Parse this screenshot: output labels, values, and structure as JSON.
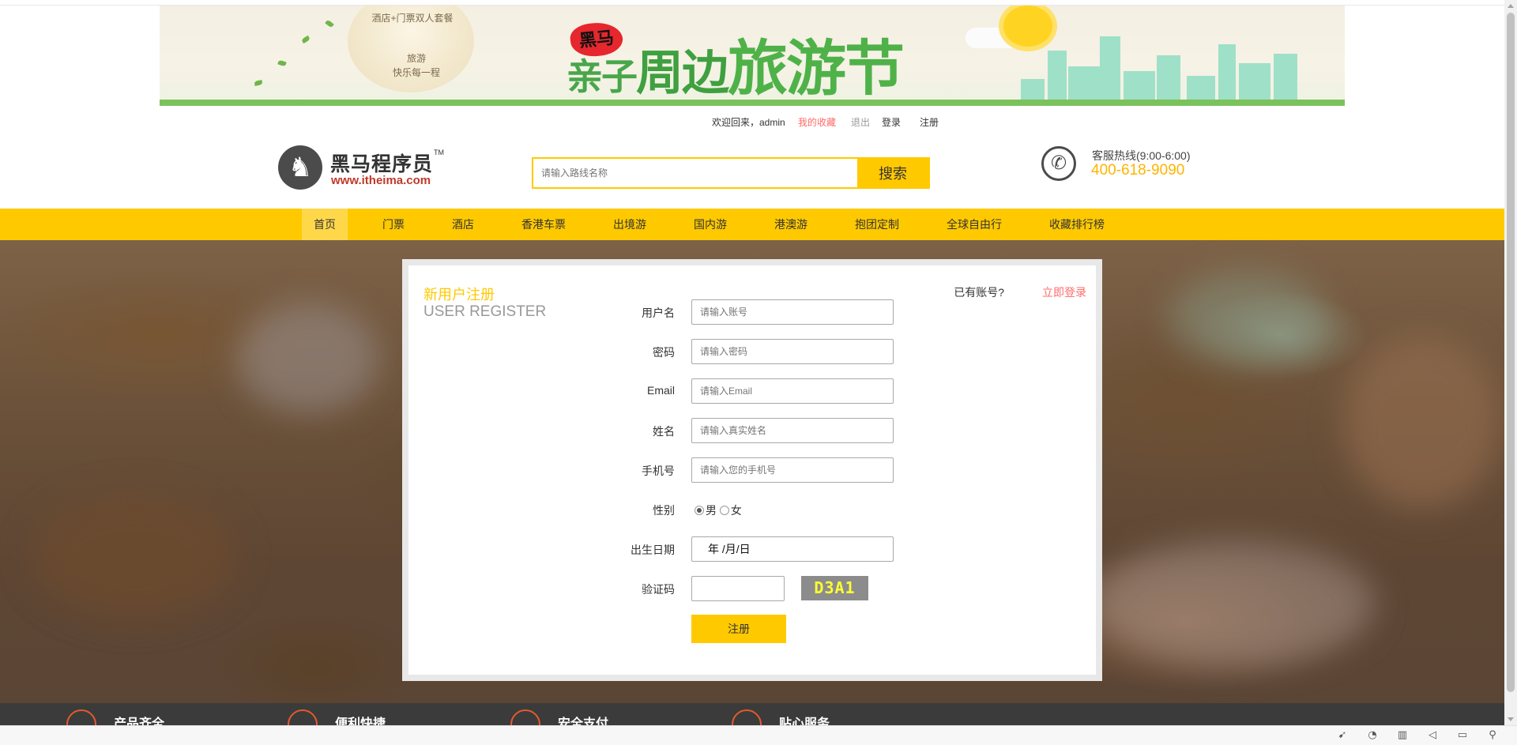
{
  "banner": {
    "bubble_line1": "酒店+门票双人套餐",
    "bubble_line2": "旅游",
    "bubble_line3": "快乐每一程",
    "brand": "黑马",
    "title_part1": "亲子",
    "title_part2": "周边",
    "title_part3": "旅游节",
    "colors": {
      "title": "#4fb249",
      "brand_blob": "#e6272d"
    }
  },
  "userbar": {
    "welcome": "欢迎回来，admin",
    "favorites": "我的收藏",
    "logout": "退出",
    "login": "登录",
    "register": "注册"
  },
  "header": {
    "logo_cn": "黑马程序员",
    "logo_tm": "TM",
    "logo_url": "www.itheima.com",
    "search_placeholder": "请输入路线名称",
    "search_button": "搜索",
    "hotline_label": "客服热线(9:00-6:00)",
    "hotline_number": "400-618-9090"
  },
  "nav": {
    "items": [
      {
        "label": "首页",
        "active": true
      },
      {
        "label": "门票"
      },
      {
        "label": "酒店"
      },
      {
        "label": "香港车票"
      },
      {
        "label": "出境游"
      },
      {
        "label": "国内游"
      },
      {
        "label": "港澳游"
      },
      {
        "label": "抱团定制"
      },
      {
        "label": "全球自由行"
      },
      {
        "label": "收藏排行榜"
      }
    ],
    "color": "#ffc900"
  },
  "register": {
    "title_cn": "新用户注册",
    "title_en": "USER REGISTER",
    "has_account": "已有账号?",
    "login_now": "立即登录",
    "fields": {
      "username": {
        "label": "用户名",
        "placeholder": "请输入账号"
      },
      "password": {
        "label": "密码",
        "placeholder": "请输入密码"
      },
      "email": {
        "label": "Email",
        "placeholder": "请输入Email"
      },
      "name": {
        "label": "姓名",
        "placeholder": "请输入真实姓名"
      },
      "phone": {
        "label": "手机号",
        "placeholder": "请输入您的手机号"
      },
      "gender": {
        "label": "性别",
        "male": "男",
        "female": "女",
        "selected": "男"
      },
      "birthday": {
        "label": "出生日期",
        "value": "年 /月/日"
      },
      "captcha": {
        "label": "验证码",
        "value": "",
        "code": "D3A1"
      }
    },
    "submit": "注册"
  },
  "footer": {
    "items": [
      "产品齐全",
      "便利快捷",
      "安全支付",
      "贴心服务"
    ]
  },
  "toolbar": {
    "icons": [
      "rocket-icon",
      "speed-icon",
      "trash-icon",
      "volume-icon",
      "window-icon",
      "zoom-icon"
    ]
  }
}
